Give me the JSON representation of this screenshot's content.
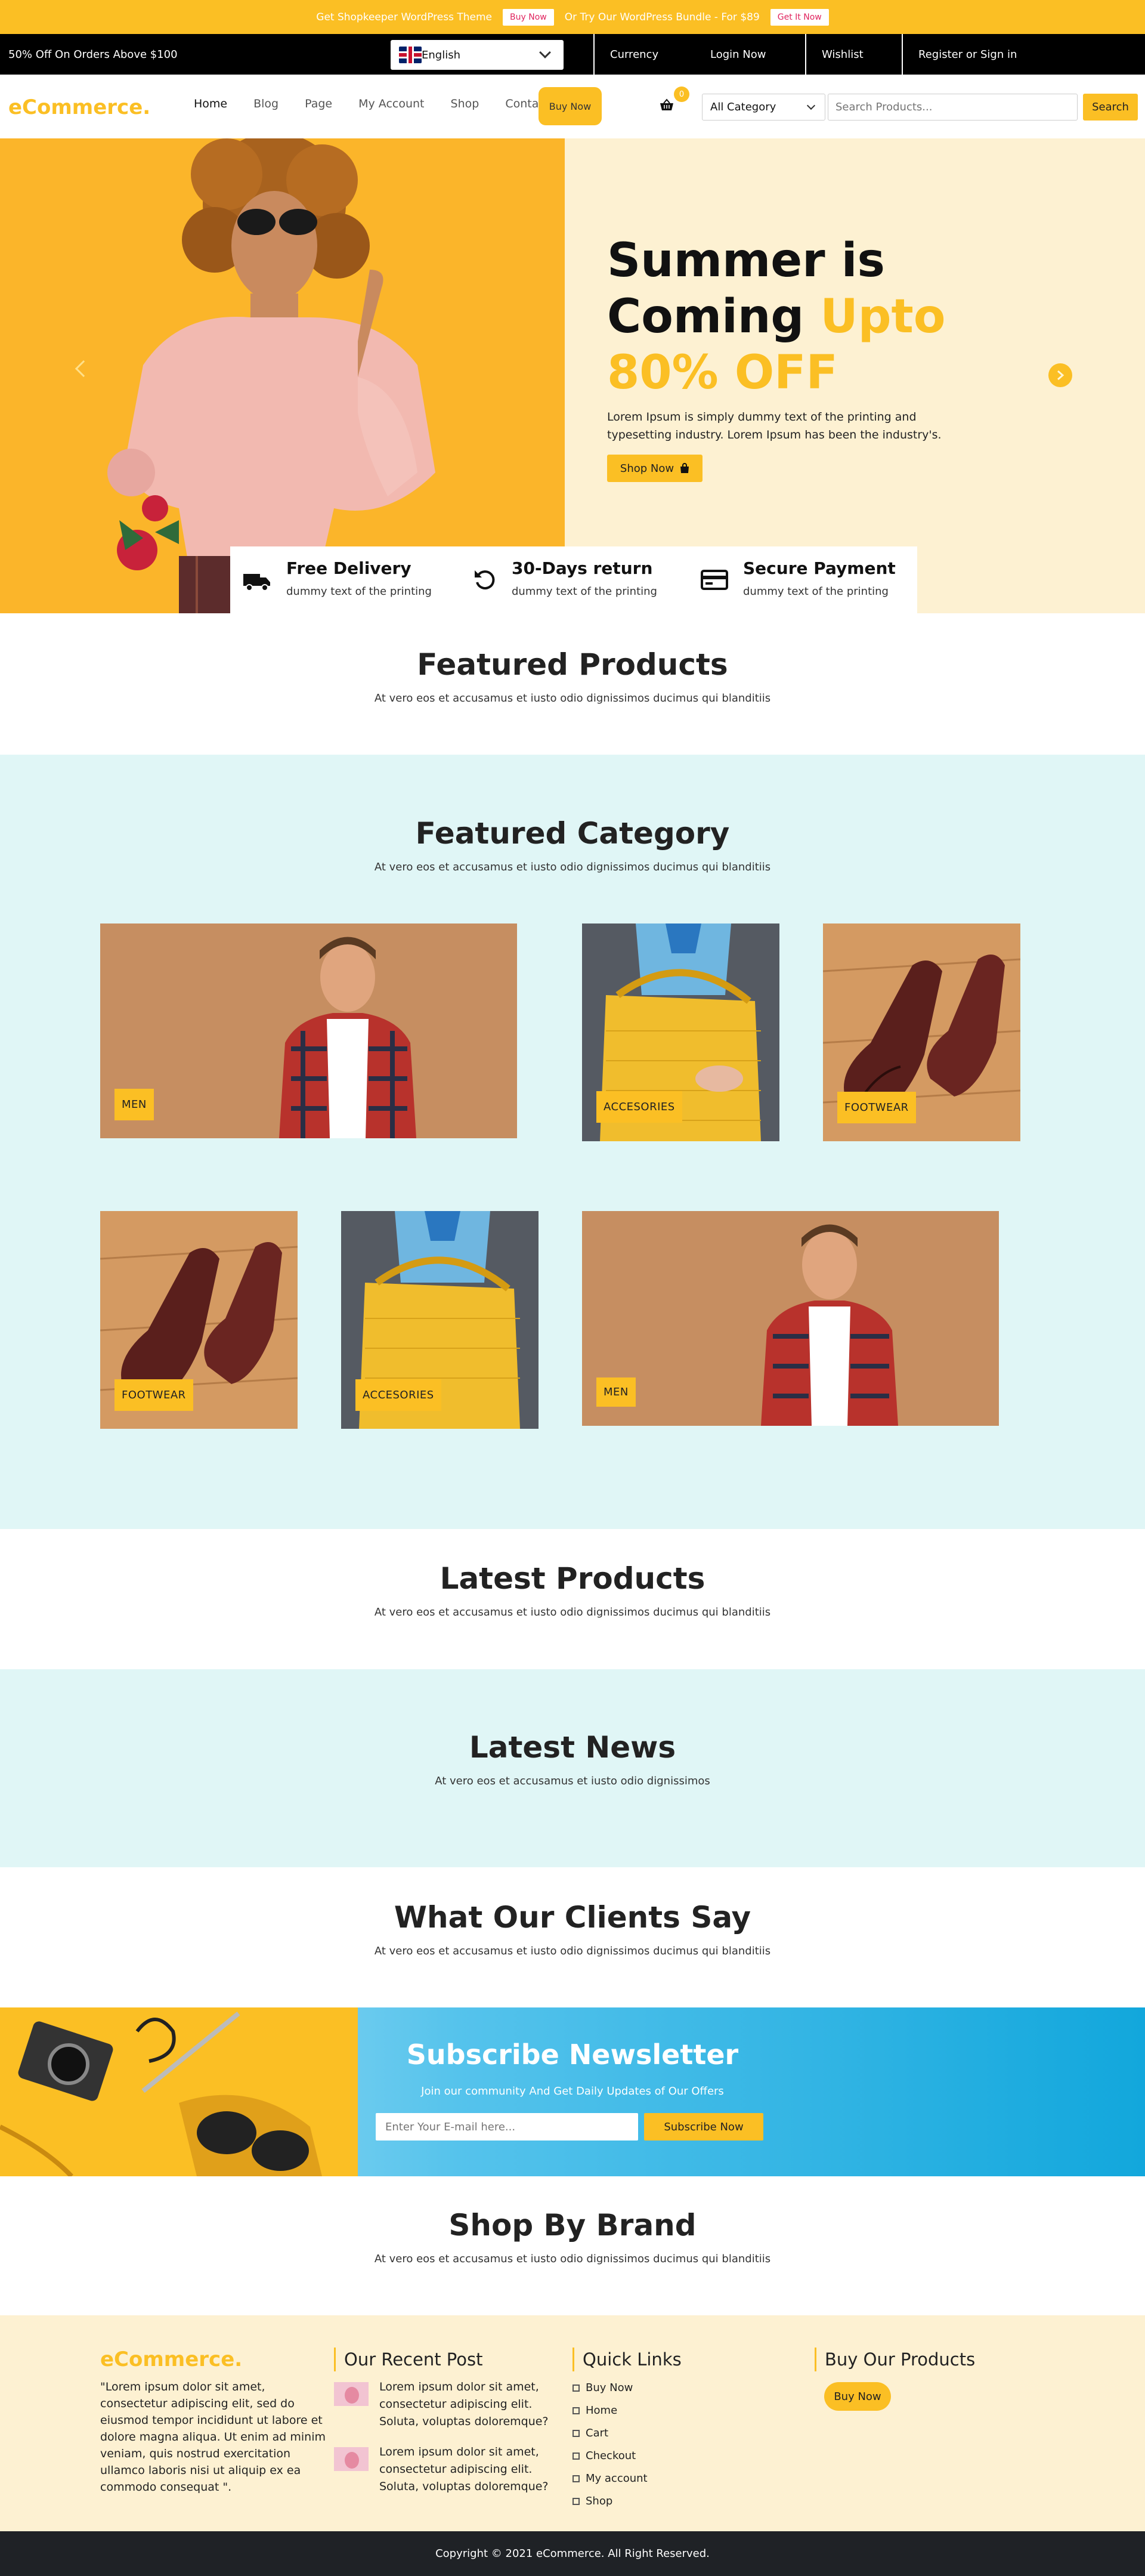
{
  "promo": {
    "text1": "Get Shopkeeper WordPress Theme",
    "btn1": "Buy Now",
    "text2": "Or Try Our WordPress Bundle - For $89",
    "btn2": "Get It Now"
  },
  "topbar": {
    "offer": "50% Off On Orders Above $100",
    "language": "English",
    "links": [
      "Currency",
      "Login Now",
      "Wishlist",
      "Register or Sign in"
    ]
  },
  "nav": {
    "logo": "eCommerce.",
    "menu": [
      "Home",
      "Blog",
      "Page",
      "My Account",
      "Shop",
      "Contact"
    ],
    "buy_now": "Buy Now",
    "cart_count": "0",
    "category": "All Category",
    "search_placeholder": "Search Products...",
    "search_button": "Search"
  },
  "hero": {
    "line1": "Summer is",
    "line2a": "Coming ",
    "line2b": "Upto",
    "line3": "80% OFF",
    "paragraph": "Lorem Ipsum is simply dummy text of the printing and typesetting industry. Lorem Ipsum has been the industry's.",
    "shop_now": "Shop Now"
  },
  "features": [
    {
      "title": "Free Delivery",
      "sub": "dummy text of the printing",
      "icon": "truck-icon"
    },
    {
      "title": "30-Days return",
      "sub": "dummy text of the printing",
      "icon": "return-icon"
    },
    {
      "title": "Secure Payment",
      "sub": "dummy text of the printing",
      "icon": "credit-card-icon"
    }
  ],
  "featured_products": {
    "title": "Featured Products",
    "sub": "At vero eos et accusamus et iusto odio dignissimos ducimus qui blanditiis"
  },
  "featured_category": {
    "title": "Featured Category",
    "sub": "At vero eos et accusamus et iusto odio dignissimos ducimus qui blanditiis",
    "cards": [
      "MEN",
      "ACCESORIES",
      "FOOTWEAR",
      "FOOTWEAR",
      "ACCESORIES",
      "MEN"
    ]
  },
  "latest_products": {
    "title": "Latest Products",
    "sub": "At vero eos et accusamus et iusto odio dignissimos ducimus qui blanditiis"
  },
  "latest_news": {
    "title": "Latest News",
    "sub": "At vero eos et accusamus et iusto odio dignissimos"
  },
  "clients": {
    "title": "What Our Clients Say",
    "sub": "At vero eos et accusamus et iusto odio dignissimos ducimus qui blanditiis"
  },
  "newsletter": {
    "title": "Subscribe Newsletter",
    "sub": "Join our community And Get Daily Updates of Our Offers",
    "placeholder": "Enter Your E-mail here...",
    "button": "Subscribe Now"
  },
  "brand": {
    "title": "Shop By Brand",
    "sub": "At vero eos et accusamus et iusto odio dignissimos ducimus qui blanditiis"
  },
  "footer": {
    "logo": "eCommerce.",
    "about": "\"Lorem ipsum dolor sit amet, consectetur adipiscing elit, sed do eiusmod tempor incididunt ut labore et dolore magna aliqua. Ut enim ad minim veniam, quis nostrud exercitation ullamco laboris nisi ut aliquip ex ea commodo consequat \".",
    "recent_title": "Our Recent Post",
    "posts": [
      "Lorem ipsum dolor sit amet, consectetur adipiscing elit. Soluta, voluptas doloremque?",
      "Lorem ipsum dolor sit amet, consectetur adipiscing elit. Soluta, voluptas doloremque?"
    ],
    "quick_title": "Quick Links",
    "quick_links": [
      "Buy Now",
      "Home",
      "Cart",
      "Checkout",
      "My account",
      "Shop"
    ],
    "buy_title": "Buy Our Products",
    "buy_button": "Buy Now"
  },
  "copyright": "Copyright © 2021 eCommerce. All Right Reserved.",
  "colors": {
    "accent": "#fbbf24",
    "mint": "#e0f6f6",
    "cream": "#fdf1d2",
    "dark": "#1f2226"
  }
}
